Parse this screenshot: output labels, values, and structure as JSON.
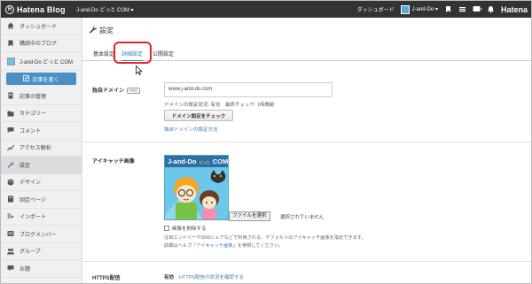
{
  "topbar": {
    "logo_mark": "H",
    "logo_text": "Hatena Blog",
    "blog_selector": "J-and-Do どっと COM ▾",
    "dashboard_link": "ダッシュボード",
    "user_name": "J-and-Do ▾",
    "brand_right": "Hatena"
  },
  "sidebar": {
    "items_top": [
      {
        "label": "ダッシュボード",
        "icon": "home-icon"
      },
      {
        "label": "購読中のブログ",
        "icon": "bookmark-icon"
      }
    ],
    "blog_name": "J-and-Do どっと COM",
    "write_button": "記事を書く",
    "items": [
      {
        "label": "記事の管理",
        "icon": "document-icon"
      },
      {
        "label": "カテゴリー",
        "icon": "folder-icon"
      },
      {
        "label": "コメント",
        "icon": "comment-icon"
      },
      {
        "label": "アクセス解析",
        "icon": "chart-icon"
      },
      {
        "label": "設定",
        "icon": "wrench-icon",
        "active": true
      },
      {
        "label": "デザイン",
        "icon": "palette-icon"
      },
      {
        "label": "固定ページ",
        "icon": "page-icon"
      },
      {
        "label": "インポート",
        "icon": "import-icon"
      },
      {
        "label": "ブログメンバー",
        "icon": "members-icon"
      },
      {
        "label": "グループ",
        "icon": "group-icon"
      },
      {
        "label": "お題",
        "icon": "topic-icon"
      }
    ]
  },
  "main": {
    "title": "設定",
    "tabs": [
      {
        "label": "基本設定",
        "active": false
      },
      {
        "label": "詳細設定",
        "active": true
      },
      {
        "label": "公開設定",
        "active": false
      }
    ],
    "domain": {
      "label": "独自ドメイン",
      "badge": "PRO",
      "value": "www.j-and-do.com",
      "status": "ドメインの設定状況: 有効　最終チェック: 1時間前",
      "check_button": "ドメイン設定をチェック",
      "help_link": "独自ドメインの設定方法"
    },
    "eyecatch": {
      "label": "アイキャッチ画像",
      "image_title_left": "J-and-Do",
      "image_title_mid": "どっと",
      "image_title_right": "COM",
      "file_button": "ファイルを選択",
      "file_status": "選択されていません",
      "remove_label": "画像を削除する",
      "note_line1": "注目エントリーやSNSシェアなどで利用される、デフォルトのアイキャッチ画像を指定できます。",
      "note_line2_prefix": "詳細はヘルプ「",
      "note_line2_link": "アイキャッチ画像",
      "note_line2_suffix": "」を参照してください。"
    },
    "https": {
      "label": "HTTPS配信",
      "value": "有効",
      "link": "HTTPS配信の状況を確認する"
    }
  },
  "colors": {
    "topbar": "#333333",
    "accent": "#3b7bc0",
    "highlight": "#e52222",
    "write_button": "#4a90c7"
  }
}
